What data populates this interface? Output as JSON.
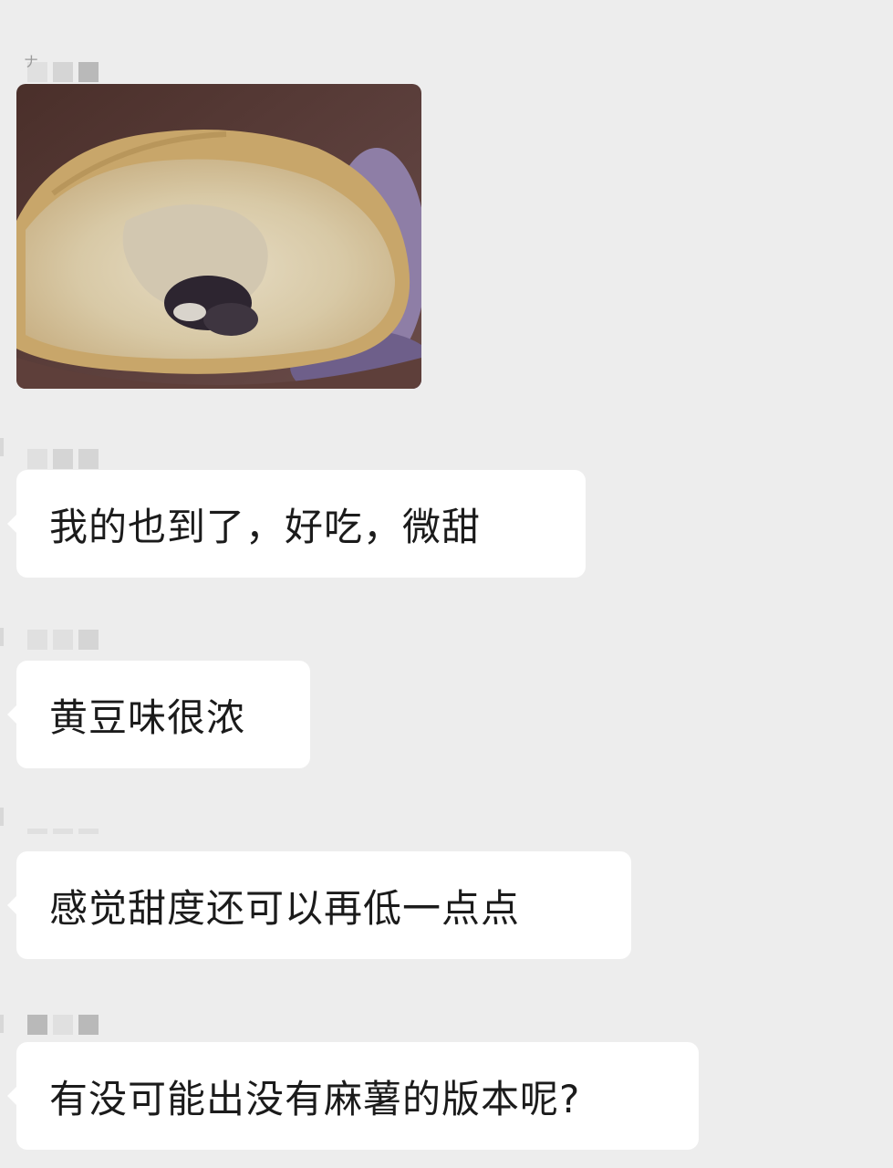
{
  "messages": [
    {
      "type": "image",
      "alt_icon": "bread-photo"
    },
    {
      "type": "text",
      "text": "我的也到了，好吃，微甜"
    },
    {
      "type": "text",
      "text": "黄豆味很浓"
    },
    {
      "type": "text",
      "text": "感觉甜度还可以再低一点点"
    },
    {
      "type": "text",
      "text": "有没可能出没有麻薯的版本呢?"
    }
  ],
  "colors": {
    "background": "#ededed",
    "bubble": "#ffffff",
    "text": "#1b1b1b"
  }
}
